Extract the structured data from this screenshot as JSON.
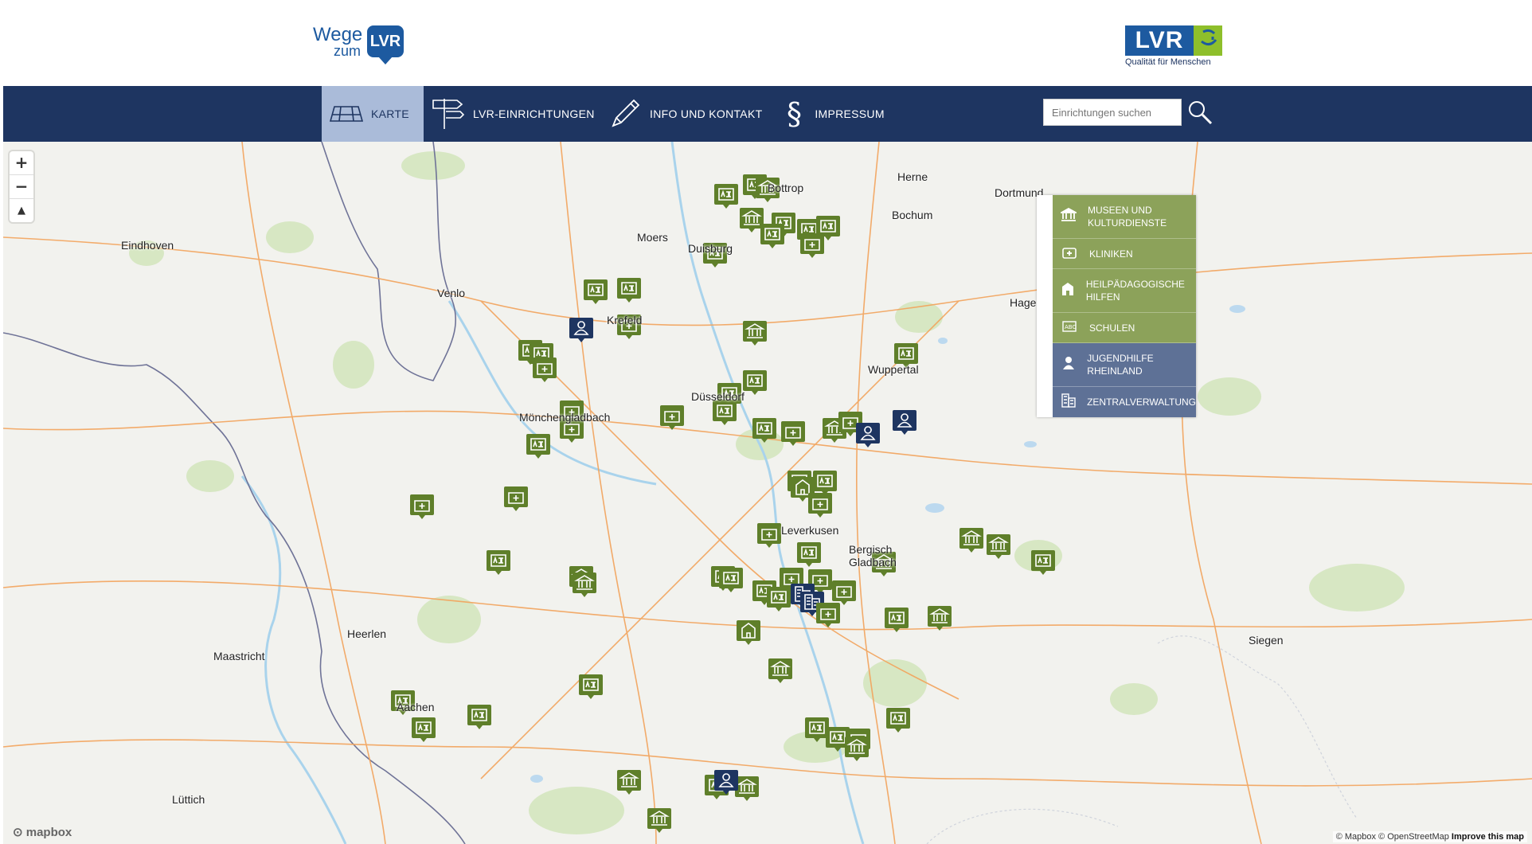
{
  "header": {
    "logo_wege_line1": "Wege",
    "logo_wege_line2": "zum",
    "logo_wege_lvr": "LVR",
    "logo_lvr_text": "LVR",
    "logo_lvr_tagline": "Qualität für Menschen"
  },
  "nav": {
    "items": [
      {
        "label": "KARTE",
        "icon": "map-icon"
      },
      {
        "label": "LVR-EINRICHTUNGEN",
        "icon": "signpost-icon"
      },
      {
        "label": "INFO UND KONTAKT",
        "icon": "pencil-icon"
      },
      {
        "label": "IMPRESSUM",
        "icon": "paragraph-icon"
      }
    ],
    "search_placeholder": "Einrichtungen suchen"
  },
  "zoom": {
    "in": "+",
    "out": "−",
    "compass": "▲"
  },
  "legend": {
    "items": [
      {
        "label": "MUSEEN UND KULTURDIENSTE",
        "icon": "museum-icon",
        "color": "#8ca25a"
      },
      {
        "label": "KLINIKEN",
        "icon": "clinic-icon",
        "color": "#8ca25a"
      },
      {
        "label": "HEILPÄDAGOGISCHE HILFEN",
        "icon": "house-icon",
        "color": "#8ca25a"
      },
      {
        "label": "SCHULEN",
        "icon": "school-icon",
        "color": "#8ca25a"
      },
      {
        "label": "JUGENDHILFE RHEINLAND",
        "icon": "person-icon",
        "color": "#5e7196"
      },
      {
        "label": "ZENTRALVERWALTUNG",
        "icon": "office-icon",
        "color": "#5e7196"
      }
    ]
  },
  "map": {
    "cities": [
      "Eindhoven",
      "Moers",
      "Bottrop",
      "Duisburg",
      "Herne",
      "Bochum",
      "Dortmund",
      "Hagen",
      "Venlo",
      "Krefeld",
      "Mönchengladbach",
      "Düsseldorf",
      "Wuppertal",
      "Leverkusen",
      "Bergisch Gladbach",
      "Heerlen",
      "Maastricht",
      "Aachen",
      "Siegen",
      "Lüttich"
    ],
    "attribution_prefix": "© Mapbox © OpenStreetMap",
    "attribution_link": "Improve this map",
    "mapbox_logo": "mapbox"
  },
  "colors": {
    "nav": "#1e3561",
    "marker_green": "#5f7f2a",
    "marker_blue": "#1e3561",
    "accent": "#1d5aa0"
  }
}
